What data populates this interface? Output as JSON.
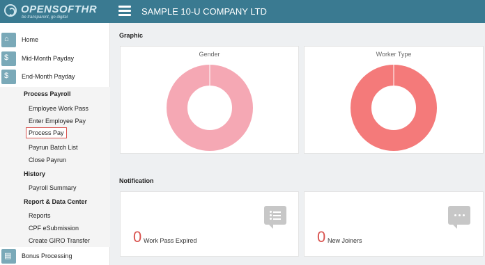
{
  "app": {
    "logo_text": "OPENSOFTHR",
    "logo_tagline": "be transparent, go digital",
    "company_name": "SAMPLE 10-U COMPANY LTD"
  },
  "sidebar": {
    "main_items": [
      {
        "label": "Home",
        "icon": "home-icon"
      },
      {
        "label": "Mid-Month Payday",
        "icon": "payday-icon"
      },
      {
        "label": "End-Month Payday",
        "icon": "payday-icon"
      },
      {
        "label": "Bonus Processing",
        "icon": "bonus-icon"
      }
    ],
    "submenu": {
      "process_payroll": {
        "heading": "Process Payroll",
        "items": [
          "Employee Work Pass",
          "Enter Employee Pay",
          "Process Pay",
          "Payrun Batch List",
          "Close Payrun"
        ]
      },
      "history": {
        "heading": "History",
        "items": [
          "Payroll Summary"
        ]
      },
      "report": {
        "heading": "Report & Data Center",
        "items": [
          "Reports",
          "CPF eSubmission",
          "Create GIRO Transfer"
        ]
      },
      "active_item": "Process Pay"
    }
  },
  "graphic": {
    "section_title": "Graphic",
    "charts": [
      {
        "title": "Gender",
        "color": "#f5a8b4",
        "value_fraction": 1.0
      },
      {
        "title": "Worker Type",
        "color": "#f47a7a",
        "value_fraction": 1.0
      }
    ]
  },
  "notification": {
    "section_title": "Notification",
    "cards": [
      {
        "count": "0",
        "label": "Work Pass Expired",
        "icon": "list-message-icon"
      },
      {
        "count": "0",
        "label": "New Joiners",
        "icon": "chat-dots-icon"
      }
    ]
  },
  "colors": {
    "topbar": "#3a7a91",
    "accent_red": "#d9534f",
    "sidebar_icon": "#7aa9b8"
  }
}
